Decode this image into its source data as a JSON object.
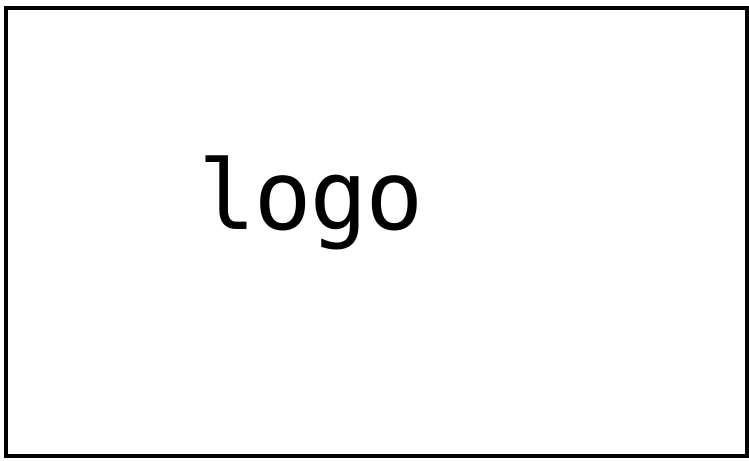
{
  "logo": {
    "text": "logo"
  },
  "colors": {
    "border": "#000000",
    "text": "#000000",
    "background": "#ffffff"
  }
}
